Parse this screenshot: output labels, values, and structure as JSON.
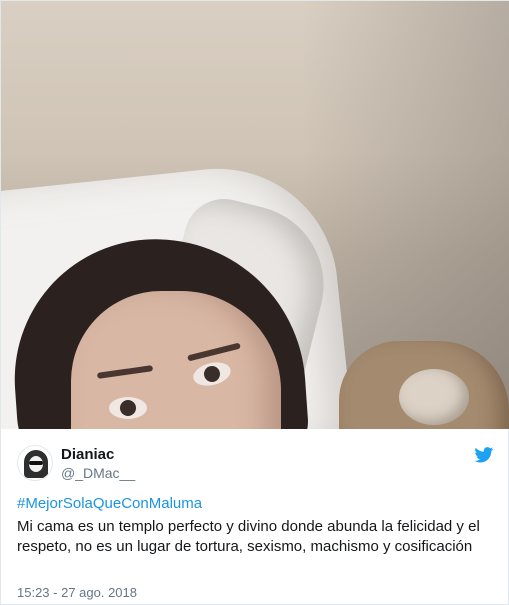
{
  "tweet": {
    "display_name": "Dianiac",
    "handle": "@_DMac__",
    "hashtag": "#MejorSolaQueConMaluma",
    "text": "Mi cama es un templo perfecto y divino donde abunda la felicidad y el respeto, no es un lugar de tortura, sexismo, machismo y cosificación",
    "timestamp": "15:23 - 27 ago. 2018"
  },
  "icons": {
    "brand": "twitter-bird-icon",
    "avatar": "avatar-image"
  },
  "colors": {
    "brand_blue": "#1da1f2",
    "hashtag_link": "#1b95e0",
    "text_primary": "#14171a",
    "text_secondary": "#657786",
    "border": "#e1e8ed"
  }
}
